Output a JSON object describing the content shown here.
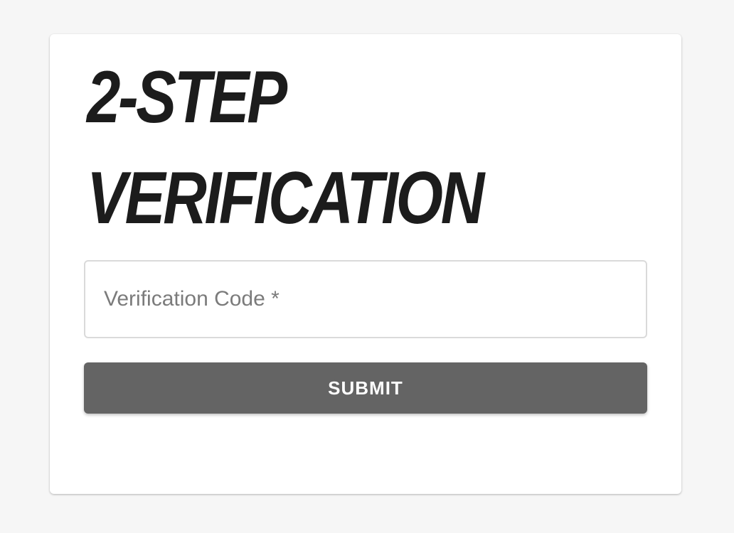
{
  "verification": {
    "title_line1": "2-STEP",
    "title_line2": "VERIFICATION",
    "code_placeholder": "Verification Code *",
    "code_value": "",
    "submit_label": "SUBMIT"
  },
  "colors": {
    "background": "#f6f6f6",
    "card": "#ffffff",
    "title": "#1c1c1c",
    "button": "#646464",
    "button_text": "#ffffff",
    "placeholder": "#7b7b7b"
  }
}
